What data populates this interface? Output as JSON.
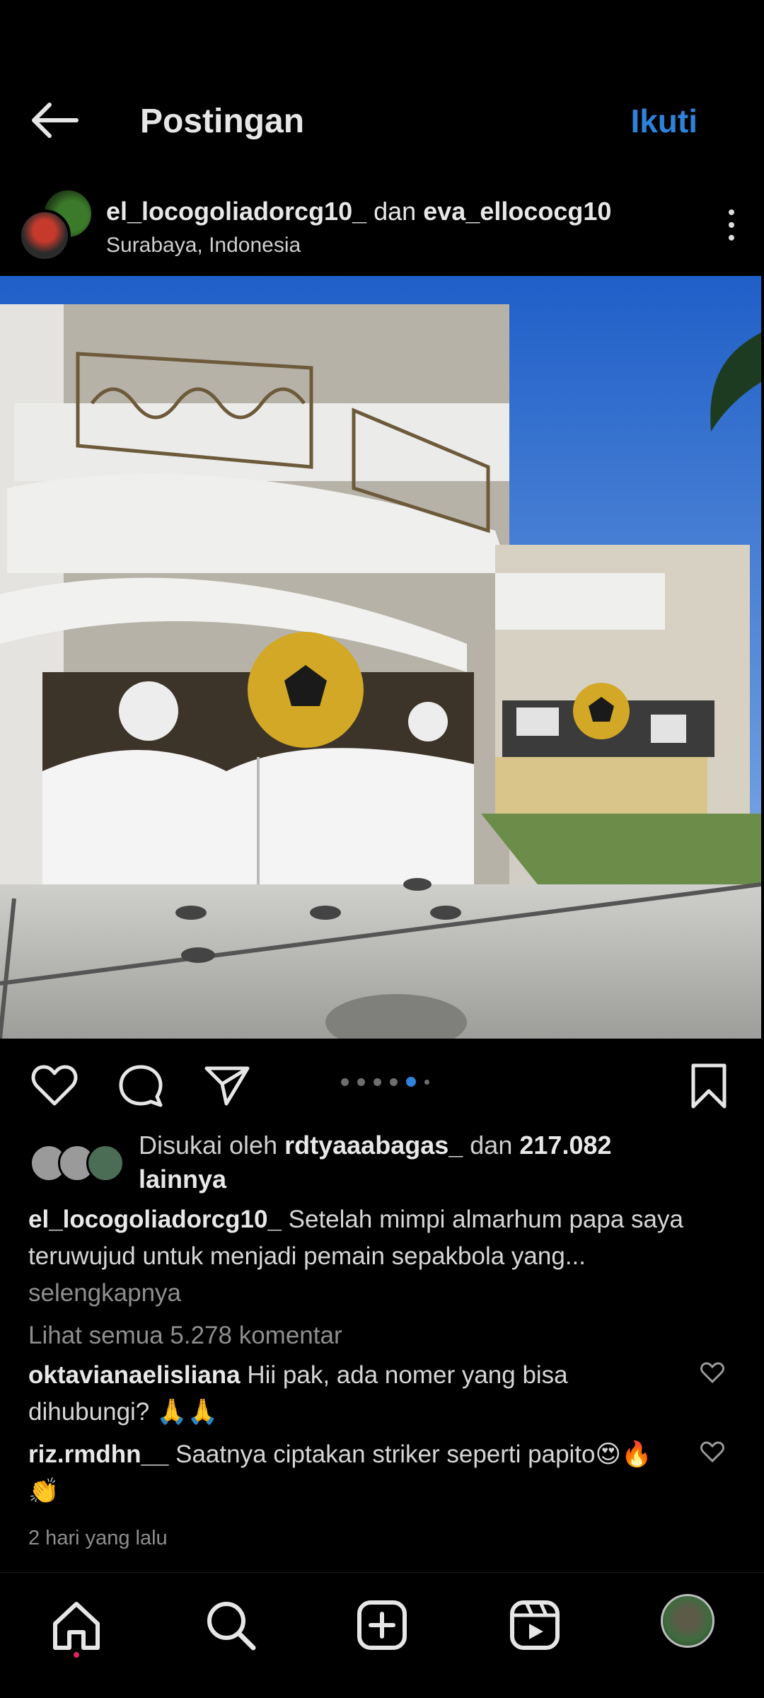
{
  "header": {
    "title": "Postingan",
    "follow_label": "Ikuti",
    "back_icon": "arrow-left-icon"
  },
  "post": {
    "author1": "el_locogoliadorcg10_",
    "conjunction": "dan",
    "author2": "eva_ellococg10",
    "location": "Surabaya, Indonesia",
    "carousel": {
      "total": 6,
      "active_index": 4
    }
  },
  "likes": {
    "prefix": "Disukai oleh",
    "user": "rdtyaaabagas_",
    "mid": "dan",
    "count": "217.082",
    "suffix": "lainnya"
  },
  "caption": {
    "username": "el_locogoliadorcg10_",
    "text": "Setelah mimpi almarhum papa saya teruwujud untuk menjadi pemain sepakbola yang...",
    "more": "selengkapnya"
  },
  "comments": {
    "view_all": "Lihat semua 5.278 komentar",
    "items": [
      {
        "username": "oktavianaelisliana",
        "text": "Hii pak, ada nomer yang bisa dihubungi? 🙏🙏"
      },
      {
        "username": "riz.rmdhn__",
        "text": "Saatnya ciptakan striker seperti papito😍🔥👏"
      }
    ]
  },
  "timestamp": "2 hari yang lalu",
  "nav": [
    "home-icon",
    "search-icon",
    "add-post-icon",
    "reels-icon",
    "profile-avatar"
  ],
  "colors": {
    "accent": "#2f82d9",
    "background": "#000000",
    "notification": "#e0245e"
  }
}
